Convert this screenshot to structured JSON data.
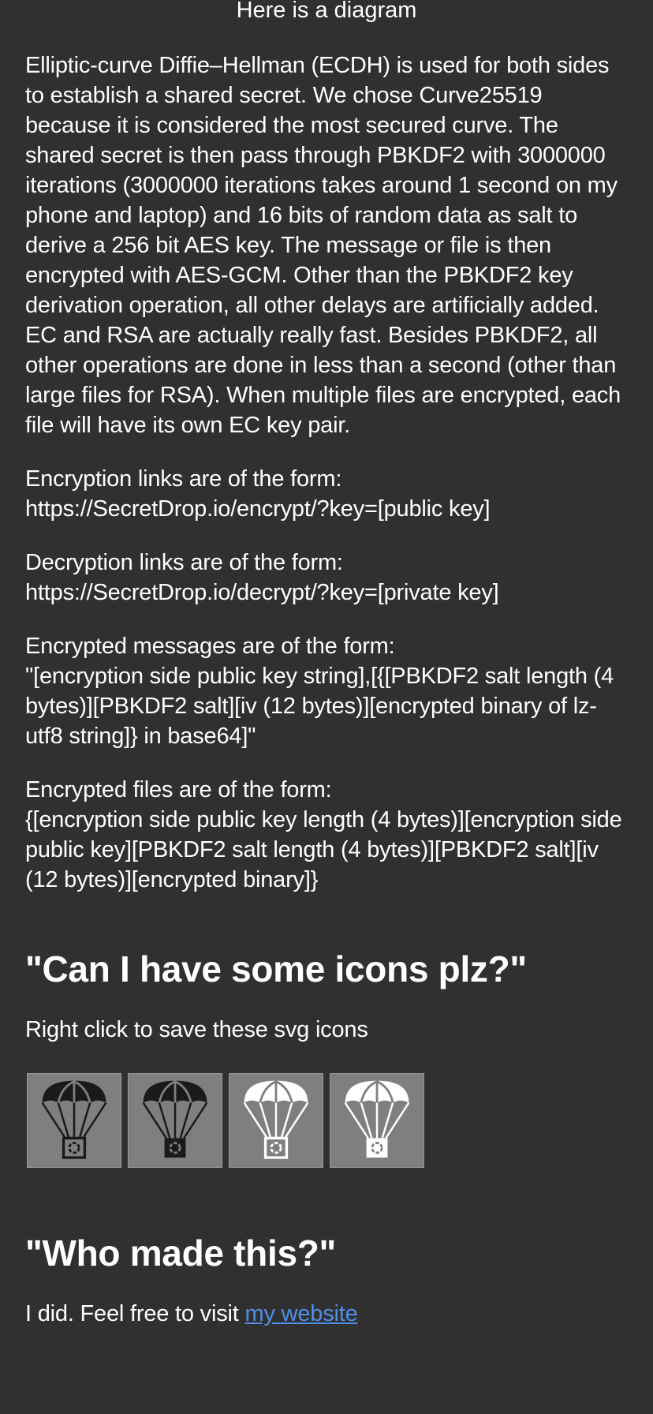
{
  "diagram": {
    "caption": "Here is a diagram"
  },
  "description": {
    "ecdh_paragraph": "Elliptic-curve Diffie–Hellman (ECDH) is used for both sides to establish a shared secret. We chose Curve25519 because it is considered the most secured curve. The shared secret is then pass through PBKDF2 with 3000000 iterations (3000000 iterations takes around 1 second on my phone and laptop) and 16 bits of random data as salt to derive a 256 bit AES key. The message or file is then encrypted with AES-GCM. Other than the PBKDF2 key derivation operation, all other delays are artificially added. EC and RSA are actually really fast. Besides PBKDF2, all other operations are done in less than a second (other than large files for RSA). When multiple files are encrypted, each file will have its own EC key pair.",
    "encryption_links_label": "Encryption links are of the form:",
    "encryption_links_value": "https://SecretDrop.io/encrypt/?key=[public key]",
    "decryption_links_label": "Decryption links are of the form:",
    "decryption_links_value": "https://SecretDrop.io/decrypt/?key=[private key]",
    "encrypted_messages_label": "Encrypted messages are of the form:",
    "encrypted_messages_value": "\"[encryption side public key string],[{[PBKDF2 salt length (4 bytes)][PBKDF2 salt][iv (12 bytes)][encrypted binary of lz-utf8 string]} in base64]\"",
    "encrypted_files_label": "Encrypted files are of the form:",
    "encrypted_files_value": "{[encryption side public key length (4 bytes)][encryption side public key][PBKDF2 salt length (4 bytes)][PBKDF2 salt][iv (12 bytes)][encrypted binary]}"
  },
  "icons_section": {
    "heading": "\"Can I have some icons plz?\"",
    "instruction": "Right click to save these svg icons",
    "icons": [
      {
        "name": "parachute-icon-black-outline",
        "variant": "black-outline"
      },
      {
        "name": "parachute-icon-black-filled",
        "variant": "black-filled"
      },
      {
        "name": "parachute-icon-white-outline",
        "variant": "white-outline"
      },
      {
        "name": "parachute-icon-white-filled",
        "variant": "white-filled"
      }
    ]
  },
  "credits_section": {
    "heading": "\"Who made this?\"",
    "text": "I did. Feel free to visit ",
    "link_label": "my website"
  },
  "colors": {
    "background": "#303030",
    "text": "#ffffff",
    "icon_tile": "#7f7f7f",
    "link": "#4f8fe8"
  }
}
